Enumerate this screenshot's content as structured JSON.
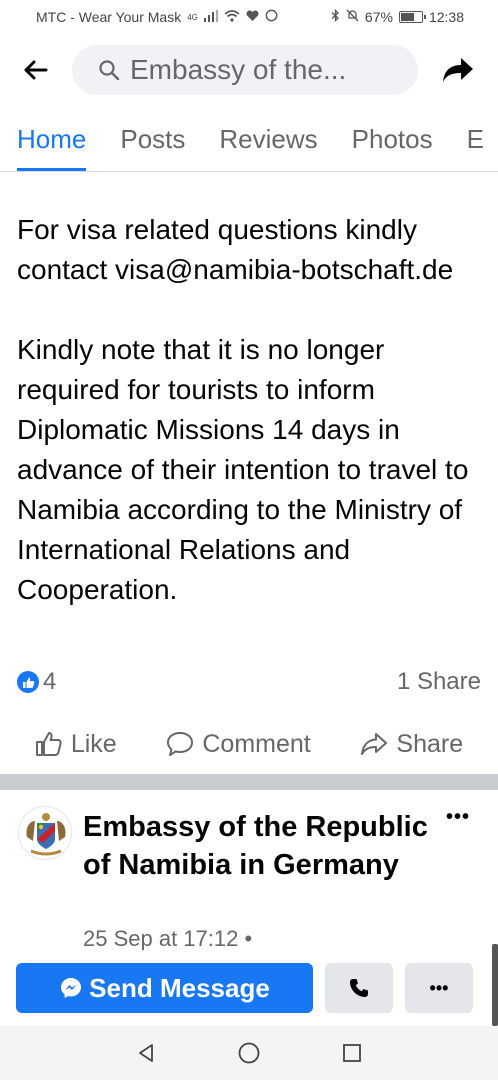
{
  "status_bar": {
    "carrier": "MTC - Wear Your Mask",
    "network": "4G",
    "battery_percent": "67%",
    "battery_level": 0.67,
    "time": "12:38"
  },
  "top_bar": {
    "search_text": "Embassy of the..."
  },
  "tabs": [
    {
      "label": "Home",
      "active": true
    },
    {
      "label": "Posts",
      "active": false
    },
    {
      "label": "Reviews",
      "active": false
    },
    {
      "label": "Photos",
      "active": false
    },
    {
      "label": "E",
      "active": false
    }
  ],
  "post": {
    "paragraph_1": "For visa related questions kindly contact visa@namibia-botschaft.de",
    "paragraph_2": "Kindly note that it is no longer required for tourists to inform Diplomatic Missions 14 days in advance of their intention to travel to Namibia according to the Ministry of International Relations and Cooperation.",
    "like_count": "4",
    "share_count": "1 Share"
  },
  "actions": {
    "like": "Like",
    "comment": "Comment",
    "share": "Share"
  },
  "next_post": {
    "page_name": "Embassy of the Republic of Namibia in Germany",
    "time": "25 Sep at 17:12 •",
    "more": "•••"
  },
  "bottom_bar": {
    "send_message": "Send Message",
    "more": "•••"
  },
  "colors": {
    "accent": "#1877f2",
    "secondary_text": "#65676b",
    "divider": "#c9ccd1"
  },
  "icons": [
    "back-arrow-icon",
    "search-icon",
    "share-arrow-icon",
    "like-badge-icon",
    "thumbs-up-icon",
    "comment-icon",
    "share-icon",
    "messenger-icon",
    "phone-icon",
    "nav-back-icon",
    "nav-home-icon",
    "nav-recents-icon"
  ]
}
